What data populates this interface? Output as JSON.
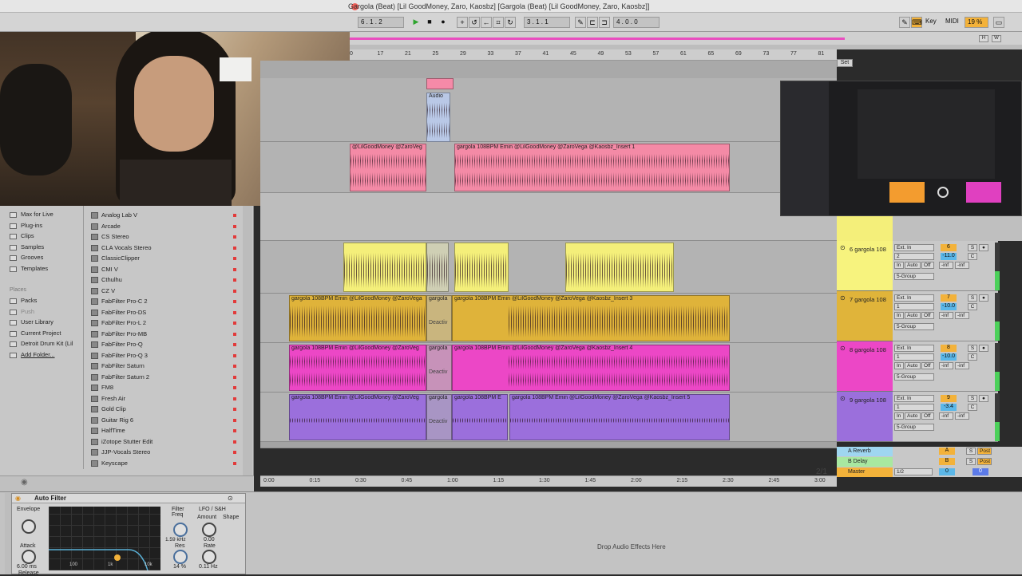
{
  "window": {
    "title": "Gargola (Beat) [Lil GoodMoney, Zaro, Kaosbz]  [Gargola (Beat) [Lil GoodMoney, Zaro, Kaosbz]]"
  },
  "transport": {
    "position": "6 . 1 . 2",
    "loop_start": "3 . 1 . 1",
    "loop_length": "4 . 0 . 0",
    "key_label": "Key",
    "midi_label": "MIDI",
    "cpu": "19 %"
  },
  "ruler": {
    "bars": [
      "0",
      "17",
      "21",
      "25",
      "29",
      "33",
      "37",
      "41",
      "45",
      "49",
      "53",
      "57",
      "61",
      "65",
      "69",
      "73",
      "77",
      "81"
    ]
  },
  "set_label": "Set",
  "arrangement": {
    "audio_clip_label": "Audio",
    "clips": [
      {
        "track": "1",
        "name": "@LilGoodMoney @ZaroVeg"
      },
      {
        "track": "1",
        "name": "gargola 108BPM Emin @LilGoodMoney @ZaroVega @Kaosbz_Insert 1"
      },
      {
        "track": "7",
        "name": "gargola 108BPM Emin @LilGoodMoney @ZaroVega"
      },
      {
        "track": "7",
        "name": "gargola 108BPM Emin @LilGoodMoney @ZaroVega @Kaosbz_Insert 3"
      },
      {
        "track": "8",
        "name": "gargola 108BPM Emin @LilGoodMoney @ZaroVeg"
      },
      {
        "track": "8",
        "name": "gargola 108BPM Emin @LilGoodMoney @ZaroVega @Kaosbz_Insert 4"
      },
      {
        "track": "9",
        "name": "gargola 108BPM Emin @LilGoodMoney @ZaroVeg"
      },
      {
        "track": "9",
        "name": "gargola 108BPM E"
      },
      {
        "track": "9",
        "name": "gargola 108BPM Emin @LilGoodMoney @ZaroVega @Kaosbz_Insert 5"
      }
    ],
    "gargola_short": "gargola",
    "deactivated": "Deactiv",
    "page_indicator": "2/1"
  },
  "tracks": [
    {
      "name": "6 gargola 108",
      "color": "#f7f37e",
      "input": "Ext. In",
      "channel": "2",
      "number": "6",
      "vol": "-11.0",
      "send": "-inf",
      "group": "5-Group"
    },
    {
      "name": "7 gargola 108",
      "color": "#e0b43a",
      "input": "Ext. In",
      "channel": "1",
      "number": "7",
      "vol": "-10.0",
      "send": "-inf",
      "group": "5-Group"
    },
    {
      "name": "8 gargola 108",
      "color": "#ec47c6",
      "input": "Ext. In",
      "channel": "1",
      "number": "8",
      "vol": "-10.0",
      "send": "-inf",
      "group": "5-Group"
    },
    {
      "name": "9 gargola 108",
      "color": "#9b6fdc",
      "input": "Ext. In",
      "channel": "1",
      "number": "9",
      "vol": "-3.4",
      "send": "-inf",
      "group": "5-Group"
    }
  ],
  "monitor": {
    "in": "In",
    "auto": "Auto",
    "off": "Off"
  },
  "returns": [
    {
      "name": "A Reverb",
      "letter": "A",
      "post": "Post",
      "color": "#9fd6f0"
    },
    {
      "name": "B Delay",
      "letter": "B",
      "post": "Post",
      "color": "#a8e8a0"
    }
  ],
  "master": {
    "name": "Master",
    "routing": "1/2",
    "number": "0",
    "vol": "0"
  },
  "browser": {
    "collections": [
      "Max for Live",
      "Plug-ins",
      "Clips",
      "Samples",
      "Grooves",
      "Templates"
    ],
    "places_heading": "Places",
    "places": [
      "Packs",
      "Push",
      "User Library",
      "Current Project",
      "Detroit Drum Kit (Lil",
      "Add Folder..."
    ],
    "plugins": [
      "Analog Lab V",
      "Arcade",
      "CS Stereo",
      "CLA Vocals Stereo",
      "ClassicClipper",
      "CMI V",
      "Cthulhu",
      "CZ V",
      "FabFilter Pro-C 2",
      "FabFilter Pro-DS",
      "FabFilter Pro-L 2",
      "FabFilter Pro-MB",
      "FabFilter Pro-Q",
      "FabFilter Pro-Q 3",
      "FabFilter Saturn",
      "FabFilter Saturn 2",
      "FM8",
      "Fresh Air",
      "Gold Clip",
      "Guitar Rig 6",
      "HalfTime",
      "iZotope Stutter Edit",
      "JJP-Vocals Stereo",
      "Keyscape"
    ]
  },
  "time_axis": [
    "0:00",
    "0:15",
    "0:30",
    "0:45",
    "1:00",
    "1:15",
    "1:30",
    "1:45",
    "2:00",
    "2:15",
    "2:30",
    "2:45",
    "3:00"
  ],
  "device": {
    "name": "Auto Filter",
    "envelope": "Envelope",
    "attack": "Attack",
    "attack_val": "6.00 ms",
    "release": "Release",
    "filter_freq": "Filter Freq",
    "freq_val": "1.59 kHz",
    "res": "Res",
    "res_val": "14 %",
    "lfo": "LFO / S&H",
    "amount": "Amount",
    "amount_val": "0.00",
    "shape": "Shape",
    "rate": "Rate",
    "rate_val": "0.11 Hz",
    "phase": "Phase",
    "f100": "100",
    "f1k": "1k",
    "f10k": "10k",
    "clean": "Clean"
  },
  "drop_text": "Drop Audio Effects Here"
}
